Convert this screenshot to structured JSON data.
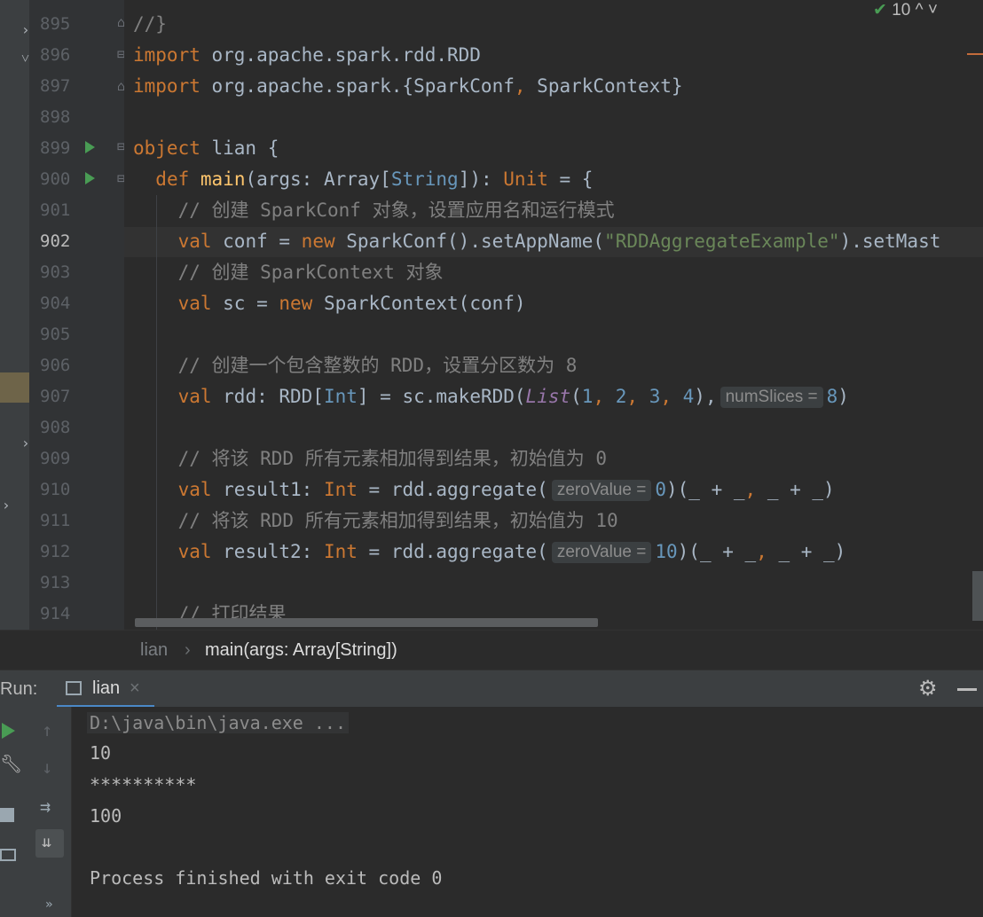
{
  "top_indicator": {
    "check": "✔",
    "count": "10",
    "nav": "^  ˅"
  },
  "gutter": {
    "line_numbers": [
      "895",
      "896",
      "897",
      "898",
      "899",
      "900",
      "901",
      "902",
      "903",
      "904",
      "905",
      "906",
      "907",
      "908",
      "909",
      "910",
      "911",
      "912",
      "913",
      "914"
    ]
  },
  "code": {
    "l895": "//}",
    "l896": {
      "kw": "import",
      "rest": " org.apache.spark.rdd.RDD"
    },
    "l897": {
      "kw": "import",
      "rest": " org.apache.spark.{SparkConf",
      "comma": ",",
      "rest2": " SparkContext}"
    },
    "l899": {
      "kw": "object",
      "rest": " lian {"
    },
    "l900": {
      "kw": "def",
      "fn": "main",
      "p1": "(args: Array[",
      "ty": "String",
      "p2": "]): ",
      "kw2": "Unit",
      "p3": " = {"
    },
    "l901": "// 创建 SparkConf 对象，设置应用名和运行模式",
    "l902": {
      "kw": "val",
      "p1": " conf = ",
      "kw2": "new",
      "p2": " SparkConf().setAppName(",
      "str": "\"RDDAggregateExample\"",
      "p3": ").setMast"
    },
    "l903": "// 创建 SparkContext 对象",
    "l904": {
      "kw": "val",
      "p1": " sc = ",
      "kw2": "new",
      "p2": " SparkContext(conf)"
    },
    "l906": "// 创建一个包含整数的 RDD，设置分区数为 8",
    "l907": {
      "kw": "val",
      "p1": " rdd: RDD[",
      "ty": "Int",
      "p2": "] = sc.makeRDD(",
      "it": "List",
      "p3": "(",
      "n1": "1",
      "c1": ", ",
      "n2": "2",
      "c2": ", ",
      "n3": "3",
      "c3": ", ",
      "n4": "4",
      "p4": "),",
      "hint": "numSlices =",
      "n5": "8",
      "p5": ")"
    },
    "l909": "// 将该 RDD 所有元素相加得到结果，初始值为 0",
    "l910": {
      "kw": "val",
      "p1": " result1: ",
      "kw2": "Int",
      "p2": " = rdd.aggregate(",
      "hint": "zeroValue =",
      "n": "0",
      "p3": ")(_ + _",
      "c": ",",
      "p4": " _ + _)"
    },
    "l911": "// 将该 RDD 所有元素相加得到结果，初始值为 10",
    "l912": {
      "kw": "val",
      "p1": " result2: ",
      "kw2": "Int",
      "p2": " = rdd.aggregate(",
      "hint": "zeroValue =",
      "n": "10",
      "p3": ")(_ + _",
      "c": ",",
      "p4": " _ + _)"
    },
    "l914": "// 打印结果"
  },
  "breadcrumb": {
    "item1": "lian",
    "separator": "›",
    "item2": "main(args: Array[String])"
  },
  "run_panel": {
    "label": "Run:",
    "tab_label": "lian",
    "tab_close": "×",
    "console": {
      "cmd": "D:\\java\\bin\\java.exe ...",
      "out1": "10",
      "out2": "**********",
      "out3": "100",
      "finish": "Process finished with exit code 0"
    }
  },
  "colors": {
    "keyword": "#cc7832",
    "function": "#ffc66d",
    "number": "#6897bb",
    "string": "#6a8759",
    "comment": "#808080",
    "run_accent": "#499c54"
  }
}
